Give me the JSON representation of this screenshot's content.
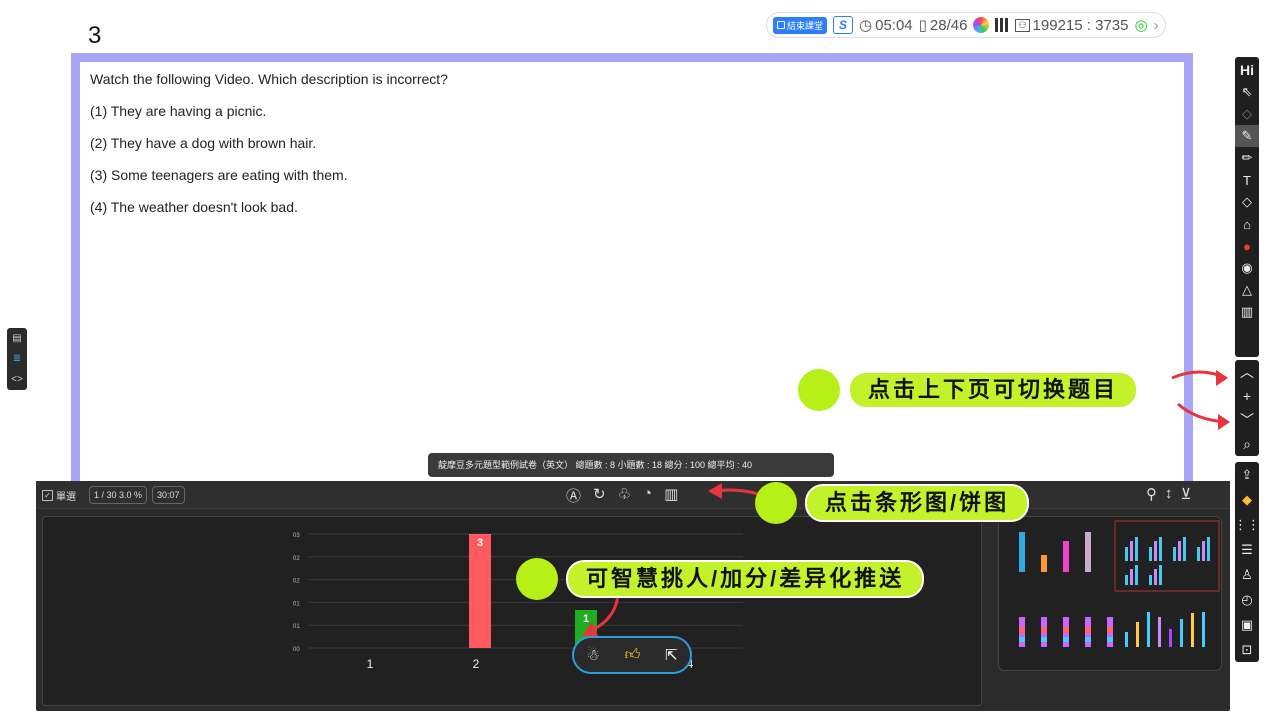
{
  "question_number": "3",
  "topbar": {
    "end_class_label": "結束課堂",
    "s_label": "S",
    "timer": "05:04",
    "pages": "28/46",
    "room_code": "199215 : 3735"
  },
  "question": {
    "prompt": "Watch the following Video. Which description is incorrect?",
    "options": [
      "(1) They are having a picnic.",
      "(2) They have a dog with brown hair.",
      "(3) Some teenagers are eating with them.",
      "(4) The weather doesn't look bad."
    ]
  },
  "left_tools": [
    "doc-icon",
    "list-icon",
    "code-icon"
  ],
  "right_toolbar": {
    "top_label": "Hi",
    "tools": [
      "pointer-icon",
      "undo-icon",
      "pen-icon",
      "marker-icon",
      "text-icon",
      "eraser-icon",
      "fill-icon",
      "palette-icon",
      "camera-icon",
      "clear-icon",
      "trash-icon"
    ],
    "nav": [
      "up-icon",
      "add-icon",
      "down-icon",
      "search-icon"
    ],
    "bottom_tools": [
      "share-icon",
      "tag-icon",
      "grid-icon",
      "notes-icon",
      "person-icon",
      "timer-icon",
      "caption-icon",
      "export-icon"
    ]
  },
  "info_bar": "靛摩豆多元題型範例試卷（英文）  總題數 : 8  小題數 : 18  總分 : 100  總平均 : 40",
  "panel": {
    "mode_label": "單選",
    "ratio": "1 / 30  3.0 %",
    "time": "30:07"
  },
  "chart_data": {
    "type": "bar",
    "categories": [
      "1",
      "2",
      "3",
      "4"
    ],
    "values": [
      0,
      3,
      1,
      0
    ],
    "data_labels": [
      "",
      "3",
      "1",
      ""
    ],
    "y_tick_labels": [
      "00",
      "01",
      "01",
      "02",
      "02",
      "03"
    ],
    "colors": [
      "#ff5a5f",
      "#ff5a5f",
      "#1fae1f",
      "#ff5a5f"
    ],
    "ylim": [
      0,
      3
    ],
    "grid": true
  },
  "callouts": {
    "switch_question": "点击上下页可切换题目",
    "bar_pie": "点击条形图/饼图",
    "smart_pick": "可智慧挑人/加分/差异化推送"
  },
  "actions": [
    "pick-person-icon",
    "thumbs-up-icon",
    "push-icon"
  ],
  "colors": {
    "frame": "#a6a6f5",
    "accent_green": "#b6f016",
    "panel_bg": "#2b2b2b",
    "arrow_red": "#e8343c"
  }
}
